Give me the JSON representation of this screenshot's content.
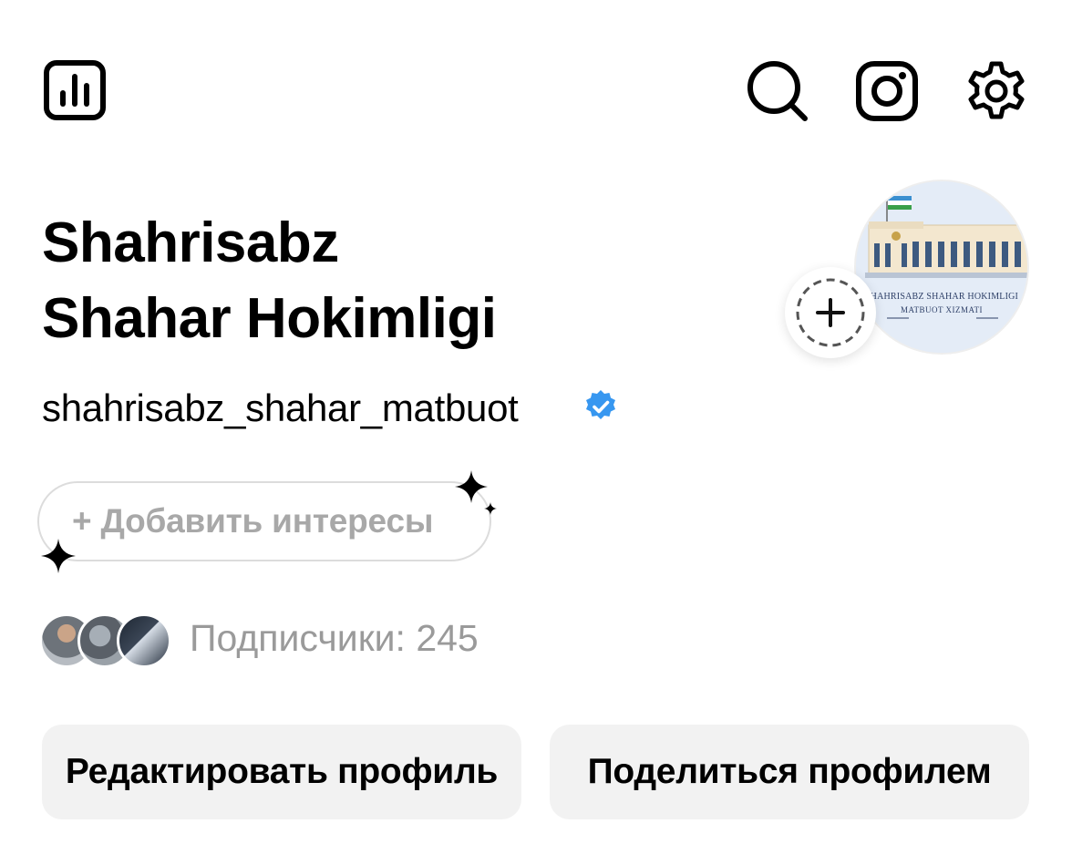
{
  "header": {
    "icons": [
      "insights-icon",
      "search-icon",
      "threads-icon",
      "gear-icon"
    ]
  },
  "profile": {
    "name_line1": "Shahrisabz",
    "name_line2": "Shahar Hokimligi",
    "username": "shahrisabz_shahar_matbuot",
    "verified": true,
    "avatar_caption_line1": "SHAHRISABZ SHAHAR HOKIMLIGI",
    "avatar_caption_line2": "MATBUOT XIZMATI"
  },
  "interests": {
    "label": "+ Добавить интересы"
  },
  "followers": {
    "label": "Подписчики: 245",
    "count": 245
  },
  "actions": {
    "edit_label": "Редактировать профиль",
    "share_label": "Поделиться профилем"
  },
  "colors": {
    "verified_blue": "#3797f0",
    "button_bg": "#f2f2f2",
    "muted_text": "#9a9a9a"
  }
}
